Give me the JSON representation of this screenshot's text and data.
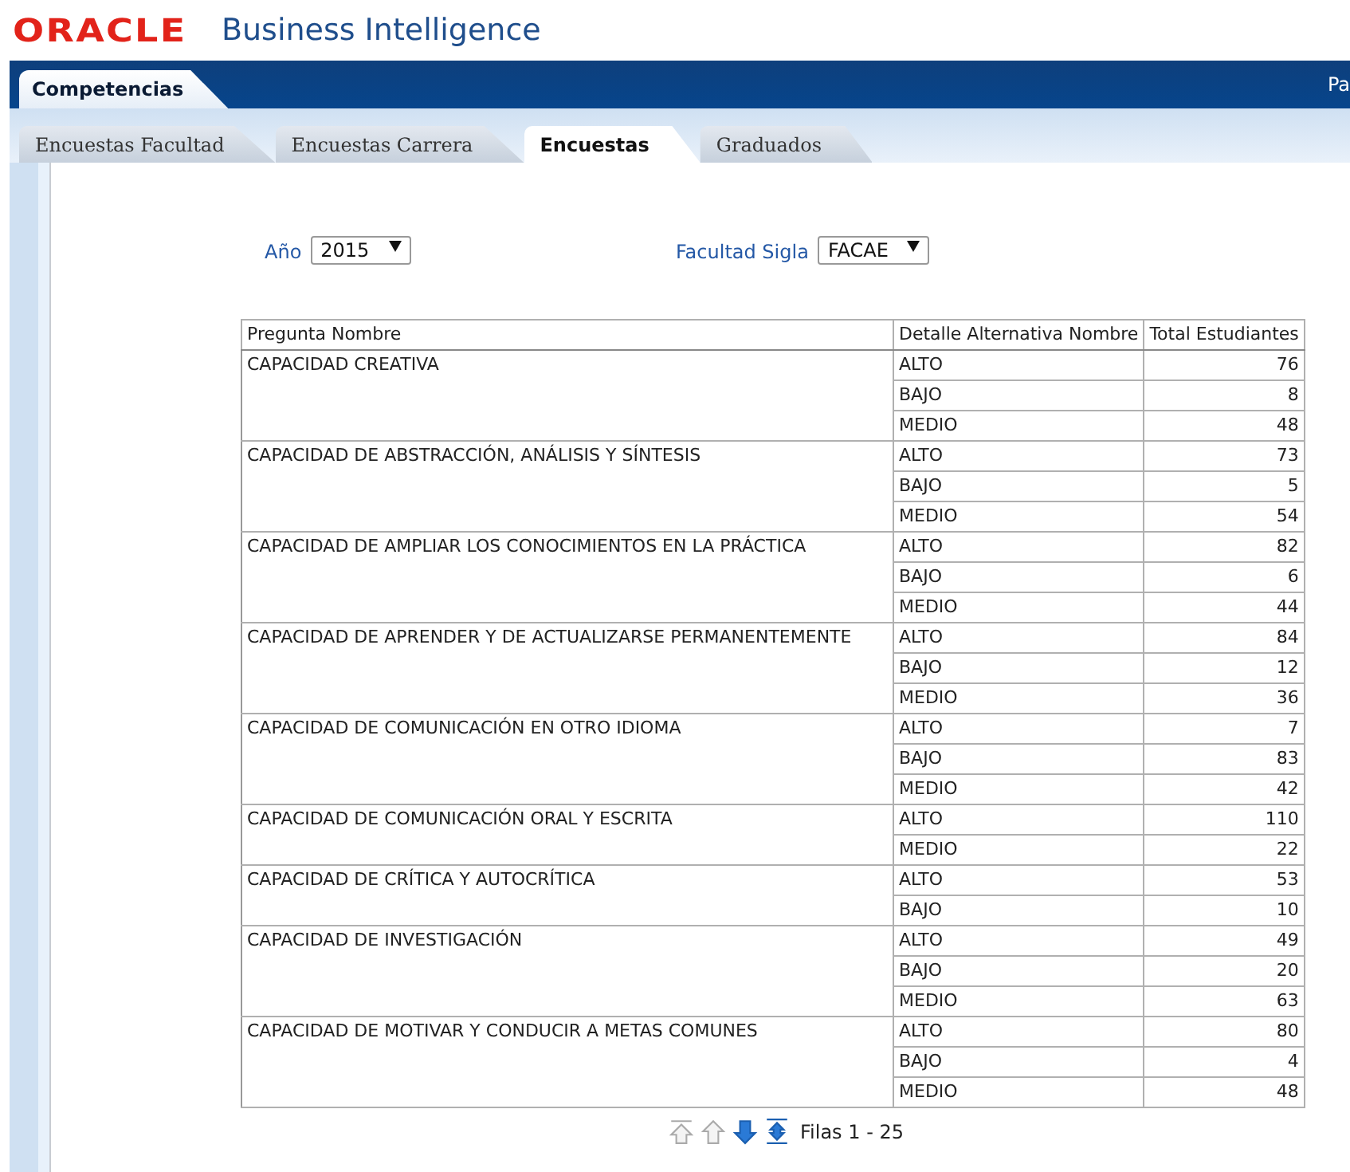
{
  "header": {
    "brand": "ORACLE",
    "product": "Business Intelligence"
  },
  "dashboard_tabs": [
    {
      "label": "Competencias",
      "selected": true
    }
  ],
  "header_right": "Pa",
  "page_tabs": [
    {
      "label": "Encuestas Facultad",
      "selected": false
    },
    {
      "label": "Encuestas Carrera",
      "selected": false
    },
    {
      "label": "Encuestas",
      "selected": true
    },
    {
      "label": "Graduados",
      "selected": false
    }
  ],
  "prompts": [
    {
      "label": "Año",
      "value": "2015"
    },
    {
      "label": "Facultad Sigla",
      "value": "FACAE"
    }
  ],
  "table": {
    "columns": [
      "Pregunta Nombre",
      "Detalle Alternativa Nombre",
      "Total Estudiantes"
    ],
    "groups": [
      {
        "question": "CAPACIDAD CREATIVA",
        "rows": [
          [
            "ALTO",
            "76"
          ],
          [
            "BAJO",
            "8"
          ],
          [
            "MEDIO",
            "48"
          ]
        ]
      },
      {
        "question": "CAPACIDAD DE ABSTRACCIÓN, ANÁLISIS Y SÍNTESIS",
        "rows": [
          [
            "ALTO",
            "73"
          ],
          [
            "BAJO",
            "5"
          ],
          [
            "MEDIO",
            "54"
          ]
        ]
      },
      {
        "question": "CAPACIDAD DE AMPLIAR LOS CONOCIMIENTOS EN LA PRÁCTICA",
        "rows": [
          [
            "ALTO",
            "82"
          ],
          [
            "BAJO",
            "6"
          ],
          [
            "MEDIO",
            "44"
          ]
        ]
      },
      {
        "question": "CAPACIDAD DE APRENDER Y DE ACTUALIZARSE PERMANENTEMENTE",
        "rows": [
          [
            "ALTO",
            "84"
          ],
          [
            "BAJO",
            "12"
          ],
          [
            "MEDIO",
            "36"
          ]
        ]
      },
      {
        "question": "CAPACIDAD DE COMUNICACIÓN EN OTRO IDIOMA",
        "rows": [
          [
            "ALTO",
            "7"
          ],
          [
            "BAJO",
            "83"
          ],
          [
            "MEDIO",
            "42"
          ]
        ]
      },
      {
        "question": "CAPACIDAD DE COMUNICACIÓN ORAL Y ESCRITA",
        "rows": [
          [
            "ALTO",
            "110"
          ],
          [
            "MEDIO",
            "22"
          ]
        ]
      },
      {
        "question": "CAPACIDAD DE CRÍTICA Y AUTOCRÍTICA",
        "rows": [
          [
            "ALTO",
            "53"
          ],
          [
            "BAJO",
            "10"
          ]
        ]
      },
      {
        "question": "CAPACIDAD DE INVESTIGACIÓN",
        "rows": [
          [
            "ALTO",
            "49"
          ],
          [
            "BAJO",
            "20"
          ],
          [
            "MEDIO",
            "63"
          ]
        ]
      },
      {
        "question": "CAPACIDAD DE MOTIVAR Y CONDUCIR A METAS COMUNES",
        "rows": [
          [
            "ALTO",
            "80"
          ],
          [
            "BAJO",
            "4"
          ],
          [
            "MEDIO",
            "48"
          ]
        ]
      }
    ]
  },
  "pager": {
    "buttons": [
      {
        "kind": "first",
        "disabled": true
      },
      {
        "kind": "previous",
        "disabled": true
      },
      {
        "kind": "next",
        "disabled": false
      },
      {
        "kind": "all",
        "disabled": false
      }
    ],
    "text": "Filas 1 - 25"
  }
}
